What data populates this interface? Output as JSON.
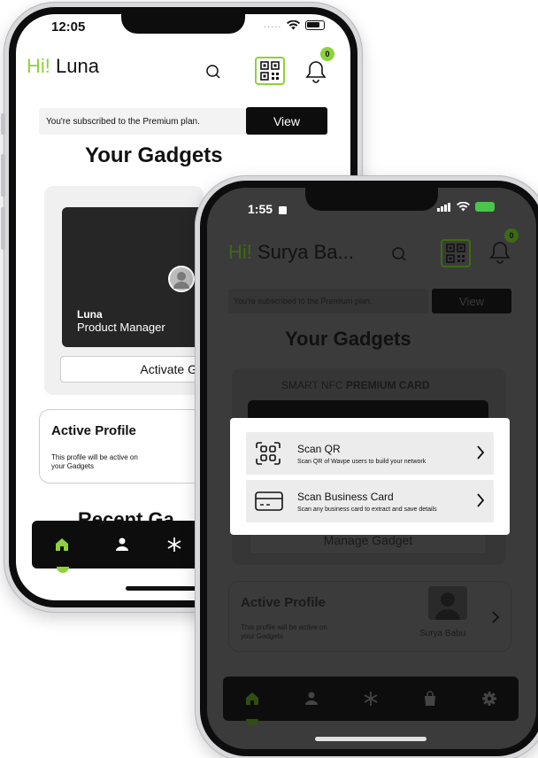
{
  "phone_back": {
    "status": {
      "time": "12:05"
    },
    "greeting": {
      "hi": "Hi!",
      "name": "Luna"
    },
    "notification_count": "0",
    "subscription": {
      "text": "You're subscribed to the Premium plan.",
      "button": "View"
    },
    "section_title": "Your Gadgets",
    "card": {
      "name": "Luna",
      "role": "Product Manager"
    },
    "activate_button": "Activate G",
    "active_profile": {
      "title": "Active Profile",
      "description_line1": "This profile will be active on",
      "description_line2": "your Gadgets"
    },
    "recent_title": "Recent Ga",
    "nav": [
      "home-icon",
      "user-icon",
      "snowflake-icon"
    ]
  },
  "phone_front": {
    "status": {
      "time": "1:55"
    },
    "greeting": {
      "hi": "Hi!",
      "name": "Surya Ba..."
    },
    "notification_count": "0",
    "subscription": {
      "text": "You're subscribed to the Premium plan.",
      "button": "View"
    },
    "section_title": "Your Gadgets",
    "card_label": {
      "normal": "SMART NFC ",
      "bold": "PREMIUM CARD"
    },
    "manage_button": "Manage Gadget",
    "active_profile": {
      "title": "Active Profile",
      "description_line1": "This profile will be active on",
      "description_line2": "your Gadgets",
      "profile_name": "Surya Babu"
    },
    "popup": {
      "items": [
        {
          "icon": "scan-qr-icon",
          "title": "Scan QR",
          "description": "Scan QR of Wavpe users to build your network"
        },
        {
          "icon": "business-card-icon",
          "title": "Scan Business Card",
          "description": "Scan any business card to extract and save details"
        }
      ]
    },
    "nav": [
      "home-icon",
      "user-icon",
      "snowflake-icon",
      "bag-icon",
      "gear-icon"
    ]
  },
  "colors": {
    "accent": "#8fd13c",
    "dark": "#0d0d0d",
    "overlay": "#3b3b3b",
    "battery": "#49c54a"
  }
}
